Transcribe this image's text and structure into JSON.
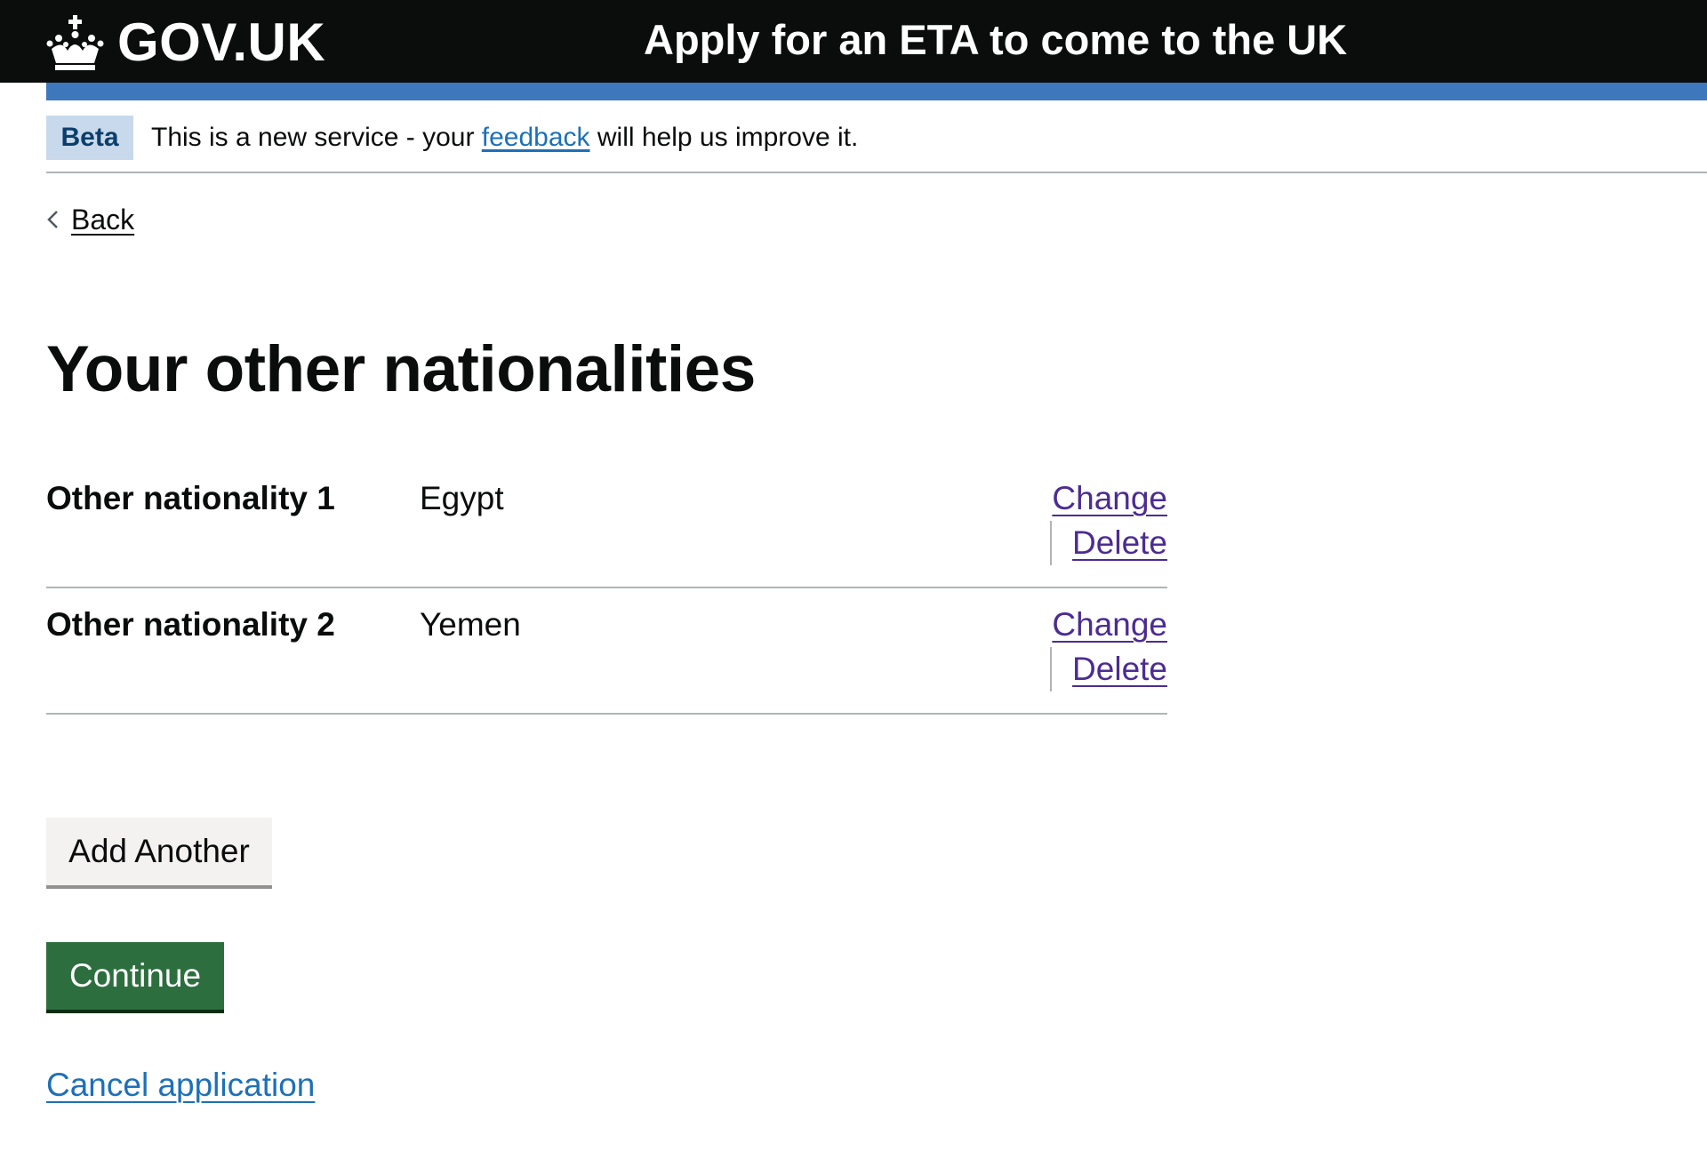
{
  "header": {
    "logo_text": "GOV.UK",
    "service_name": "Apply for an ETA to come to the UK"
  },
  "phase_banner": {
    "tag": "Beta",
    "text_before": "This is a new service - your ",
    "link_text": "feedback",
    "text_after": " will help us improve it."
  },
  "back_link": {
    "label": "Back"
  },
  "page_title": "Your other nationalities",
  "summary": {
    "rows": [
      {
        "key": "Other nationality 1",
        "value": "Egypt",
        "change_label": "Change",
        "delete_label": "Delete"
      },
      {
        "key": "Other nationality 2",
        "value": "Yemen",
        "change_label": "Change",
        "delete_label": "Delete"
      }
    ]
  },
  "actions": {
    "add_another_label": "Add Another",
    "continue_label": "Continue",
    "cancel_label": "Cancel application"
  },
  "colors": {
    "header_bg": "#0b0c0c",
    "header_stripe": "#3f77bd",
    "link": "#1d70b8",
    "visited_link": "#4c2c92",
    "primary_button": "#2d6e3e",
    "secondary_button": "#f3f2f1",
    "beta_tag_bg": "#c8d9ec"
  }
}
